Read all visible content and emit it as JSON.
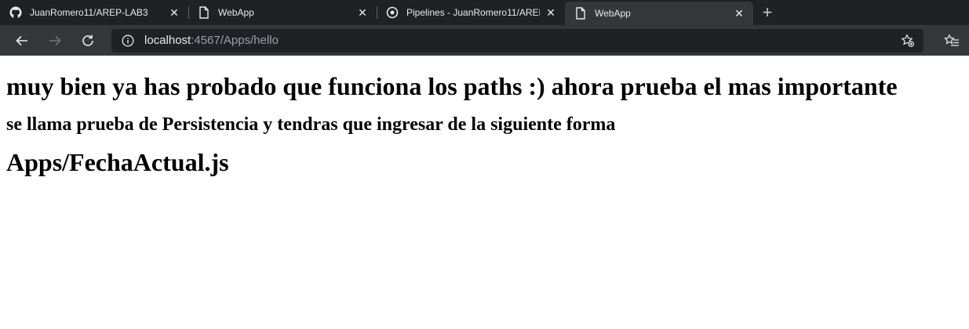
{
  "browser": {
    "tabs": [
      {
        "title": "JuanRomero11/AREP-LAB3",
        "icon": "github-icon",
        "active": false
      },
      {
        "title": "WebApp",
        "icon": "page-icon",
        "active": false
      },
      {
        "title": "Pipelines - JuanRomero11/AREP-",
        "icon": "pipelines-icon",
        "active": false
      },
      {
        "title": "WebApp",
        "icon": "page-icon",
        "active": true
      }
    ],
    "new_tab_label": "+",
    "address": {
      "host": "localhost",
      "rest": ":4567/Apps/hello"
    }
  },
  "page": {
    "heading1": "muy bien ya has probado que funciona los paths :) ahora prueba el mas importante",
    "heading2": "se llama prueba de Persistencia y tendras que ingresar de la siguiente forma",
    "heading3": "Apps/FechaActual.js"
  },
  "colors": {
    "tabbar": "#202124",
    "toolbar": "#35363a",
    "omnibox": "#202124",
    "page_bg": "#ffffff"
  }
}
